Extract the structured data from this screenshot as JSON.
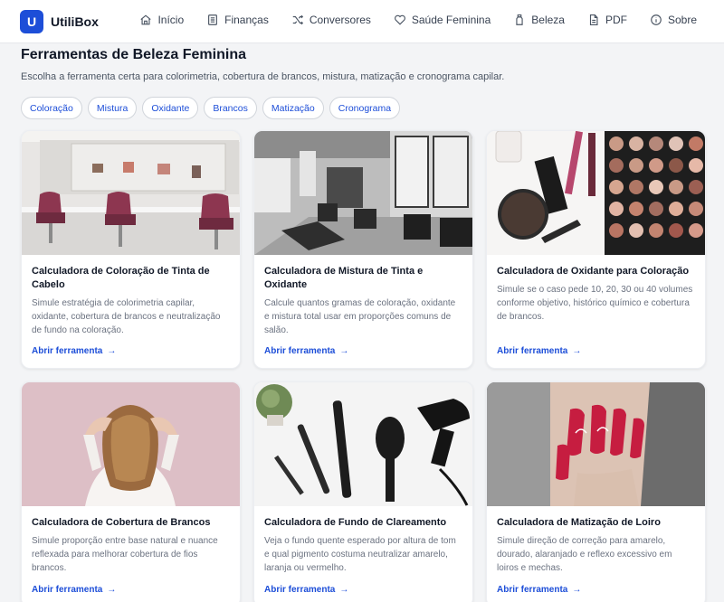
{
  "brand": {
    "initial": "U",
    "name": "UtiliBox"
  },
  "nav": [
    {
      "label": "Início",
      "icon": "home-icon"
    },
    {
      "label": "Finanças",
      "icon": "document-icon"
    },
    {
      "label": "Conversores",
      "icon": "shuffle-icon"
    },
    {
      "label": "Saúde Feminina",
      "icon": "heart-icon"
    },
    {
      "label": "Beleza",
      "icon": "bottle-icon"
    },
    {
      "label": "PDF",
      "icon": "file-icon"
    },
    {
      "label": "Sobre",
      "icon": "info-icon"
    }
  ],
  "page": {
    "title": "Ferramentas de Beleza Feminina",
    "subtitle": "Escolha a ferramenta certa para colorimetria, cobertura de brancos, mistura, matização e cronograma capilar."
  },
  "chips": [
    "Coloração",
    "Mistura",
    "Oxidante",
    "Brancos",
    "Matização",
    "Cronograma"
  ],
  "cards": [
    {
      "title": "Calculadora de Coloração de Tinta de Cabelo",
      "desc": "Simule estratégia de colorimetria capilar, oxidante, cobertura de brancos e neutralização de fundo na coloração.",
      "link": "Abrir ferramenta",
      "image": "salon-chairs-photo"
    },
    {
      "title": "Calculadora de Mistura de Tinta e Oxidante",
      "desc": "Calcule quantos gramas de coloração, oxidante e mistura total usar em proporções comuns de salão.",
      "link": "Abrir ferramenta",
      "image": "salon-bw-photo"
    },
    {
      "title": "Calculadora de Oxidante para Coloração",
      "desc": "Simule se o caso pede 10, 20, 30 ou 40 volumes conforme objetivo, histórico químico e cobertura de brancos.",
      "link": "Abrir ferramenta",
      "image": "makeup-palette-photo"
    },
    {
      "title": "Calculadora de Cobertura de Brancos",
      "desc": "Simule proporção entre base natural e nuance reflexada para melhorar cobertura de fios brancos.",
      "link": "Abrir ferramenta",
      "image": "woman-hair-photo"
    },
    {
      "title": "Calculadora de Fundo de Clareamento",
      "desc": "Veja o fundo quente esperado por altura de tom e qual pigmento costuma neutralizar amarelo, laranja ou vermelho.",
      "link": "Abrir ferramenta",
      "image": "hair-tools-photo"
    },
    {
      "title": "Calculadora de Matização de Loiro",
      "desc": "Simule direção de correção para amarelo, dourado, alaranjado e reflexo excessivo em loiros e mechas.",
      "link": "Abrir ferramenta",
      "image": "nails-photo"
    }
  ],
  "colors": {
    "accent": "#1d4ed8",
    "background": "#f3f4f6",
    "card": "#ffffff"
  }
}
